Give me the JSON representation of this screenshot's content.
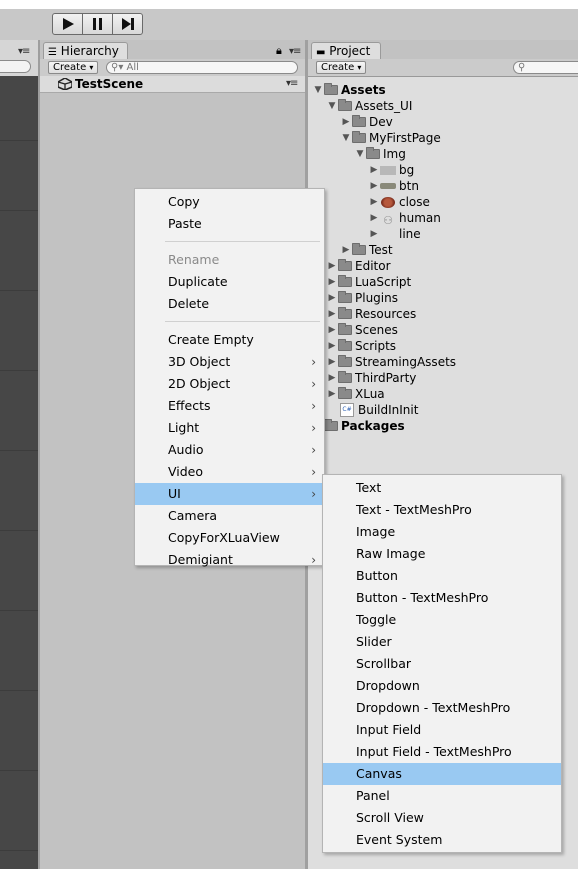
{
  "toolbar": {
    "play_icon": "play-icon",
    "pause_icon": "pause-icon",
    "step_icon": "step-icon"
  },
  "hierarchy": {
    "tab_label": "Hierarchy",
    "create_label": "Create",
    "search_placeholder": "All",
    "scene_name": "TestScene"
  },
  "project": {
    "tab_label": "Project",
    "create_label": "Create",
    "tree": [
      {
        "label": "Assets",
        "depth": 0,
        "arrow": "down",
        "icon": "folder",
        "bold": true
      },
      {
        "label": "Assets_UI",
        "depth": 1,
        "arrow": "down",
        "icon": "folder"
      },
      {
        "label": "Dev",
        "depth": 2,
        "arrow": "right",
        "icon": "folder"
      },
      {
        "label": "MyFirstPage",
        "depth": 2,
        "arrow": "down",
        "icon": "folder"
      },
      {
        "label": "Img",
        "depth": 3,
        "arrow": "down",
        "icon": "folder"
      },
      {
        "label": "bg",
        "depth": 4,
        "arrow": "right",
        "icon": "sprite-bg"
      },
      {
        "label": "btn",
        "depth": 4,
        "arrow": "right",
        "icon": "sprite-btn"
      },
      {
        "label": "close",
        "depth": 4,
        "arrow": "right",
        "icon": "sprite-close"
      },
      {
        "label": "human",
        "depth": 4,
        "arrow": "right",
        "icon": "sprite-human"
      },
      {
        "label": "line",
        "depth": 4,
        "arrow": "right",
        "icon": "sprite-line"
      },
      {
        "label": "Test",
        "depth": 2,
        "arrow": "right",
        "icon": "folder"
      },
      {
        "label": "Editor",
        "depth": 1,
        "arrow": "right",
        "icon": "folder"
      },
      {
        "label": "LuaScript",
        "depth": 1,
        "arrow": "right",
        "icon": "folder"
      },
      {
        "label": "Plugins",
        "depth": 1,
        "arrow": "right",
        "icon": "folder"
      },
      {
        "label": "Resources",
        "depth": 1,
        "arrow": "right",
        "icon": "folder"
      },
      {
        "label": "Scenes",
        "depth": 1,
        "arrow": "right",
        "icon": "folder"
      },
      {
        "label": "Scripts",
        "depth": 1,
        "arrow": "right",
        "icon": "folder"
      },
      {
        "label": "StreamingAssets",
        "depth": 1,
        "arrow": "right",
        "icon": "folder"
      },
      {
        "label": "ThirdParty",
        "depth": 1,
        "arrow": "right",
        "icon": "folder"
      },
      {
        "label": "XLua",
        "depth": 1,
        "arrow": "right",
        "icon": "folder"
      },
      {
        "label": "BuildInInit",
        "depth": 1,
        "arrow": "none",
        "icon": "csharp-script"
      },
      {
        "label": "Packages",
        "depth": 0,
        "arrow": "none",
        "icon": "folder",
        "bold": true
      }
    ]
  },
  "context_menu": {
    "items": [
      {
        "label": "Copy"
      },
      {
        "label": "Paste"
      },
      {
        "separator": true
      },
      {
        "label": "Rename",
        "disabled": true
      },
      {
        "label": "Duplicate"
      },
      {
        "label": "Delete"
      },
      {
        "separator": true
      },
      {
        "label": "Create Empty"
      },
      {
        "label": "3D Object",
        "submenu": true
      },
      {
        "label": "2D Object",
        "submenu": true
      },
      {
        "label": "Effects",
        "submenu": true
      },
      {
        "label": "Light",
        "submenu": true
      },
      {
        "label": "Audio",
        "submenu": true
      },
      {
        "label": "Video",
        "submenu": true
      },
      {
        "label": "UI",
        "submenu": true,
        "highlighted": true
      },
      {
        "label": "Camera"
      },
      {
        "label": "CopyForXLuaView"
      },
      {
        "label": "Demigiant",
        "submenu": true
      }
    ],
    "submenu_arrow": "›"
  },
  "ui_submenu": {
    "items": [
      {
        "label": "Text"
      },
      {
        "label": "Text - TextMeshPro"
      },
      {
        "label": "Image"
      },
      {
        "label": "Raw Image"
      },
      {
        "label": "Button"
      },
      {
        "label": "Button - TextMeshPro"
      },
      {
        "label": "Toggle"
      },
      {
        "label": "Slider"
      },
      {
        "label": "Scrollbar"
      },
      {
        "label": "Dropdown"
      },
      {
        "label": "Dropdown - TextMeshPro"
      },
      {
        "label": "Input Field"
      },
      {
        "label": "Input Field - TextMeshPro"
      },
      {
        "label": "Canvas",
        "highlighted": true
      },
      {
        "label": "Panel"
      },
      {
        "label": "Scroll View"
      },
      {
        "label": "Event System"
      }
    ]
  },
  "colors": {
    "highlight": "#99c9f2",
    "menu_bg": "#f2f2f2",
    "panel_bg": "#c2c2c2",
    "project_bg": "#dedede"
  }
}
